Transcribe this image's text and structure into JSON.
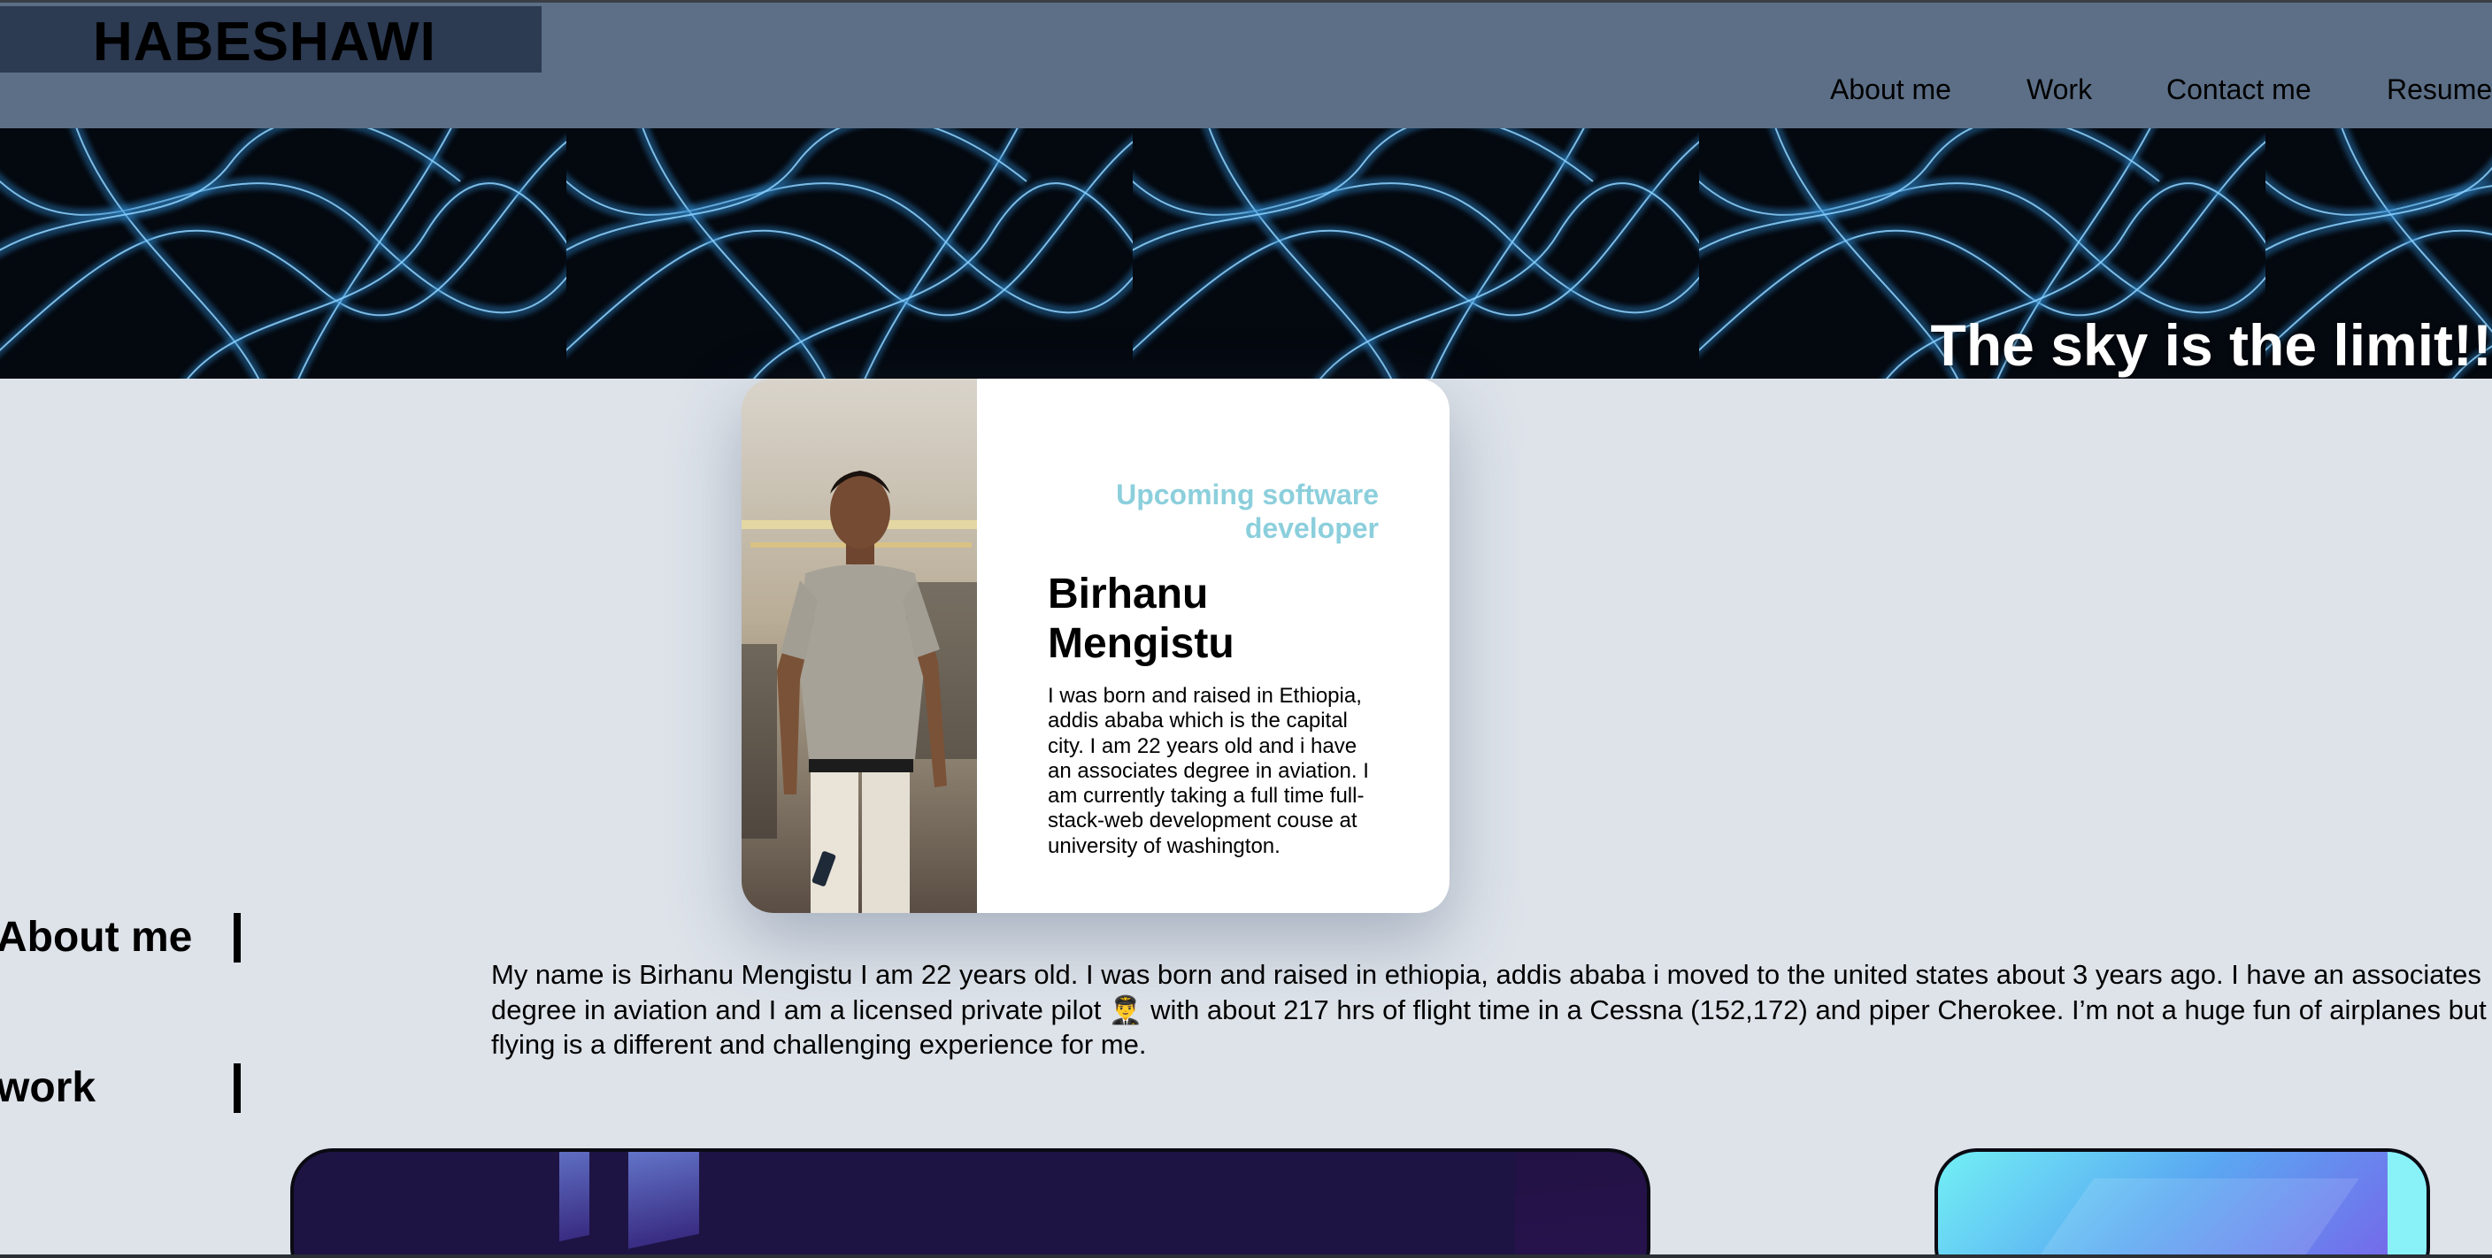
{
  "header": {
    "logo": "HABESHAWI",
    "nav": [
      {
        "label": "About me"
      },
      {
        "label": "Work"
      },
      {
        "label": "Contact me"
      },
      {
        "label": "Resume"
      }
    ]
  },
  "hero": {
    "tagline": "The sky is the limit!!"
  },
  "profile": {
    "role": "Upcoming software developer",
    "name": "Birhanu Mengistu",
    "bio": "I was born and raised in Ethiopia, addis ababa which is the capital city. I am 22 years old and i have an associates degree in aviation. I am currently taking a full time full-stack-web development couse at university of washington."
  },
  "sections": {
    "about_label": "About me",
    "work_label": "work"
  },
  "about": {
    "text": "My name is Birhanu Mengistu I am 22 years old. I was born and raised in ethiopia, addis ababa i moved to the united states about 3 years ago. I have an associates degree in aviation and I am a licensed private pilot 👨‍✈️ with about 217 hrs of flight time in a Cessna (152,172) and piper Cherokee. I’m not a huge fun of airplanes but flying is a different and challenging experience for me."
  },
  "colors": {
    "header_bg": "#5c6f87",
    "logo_bg": "#2c3a52",
    "page_bg": "#dee3ea",
    "role_accent": "#8ccfdc",
    "tagline": "#ffffff"
  }
}
